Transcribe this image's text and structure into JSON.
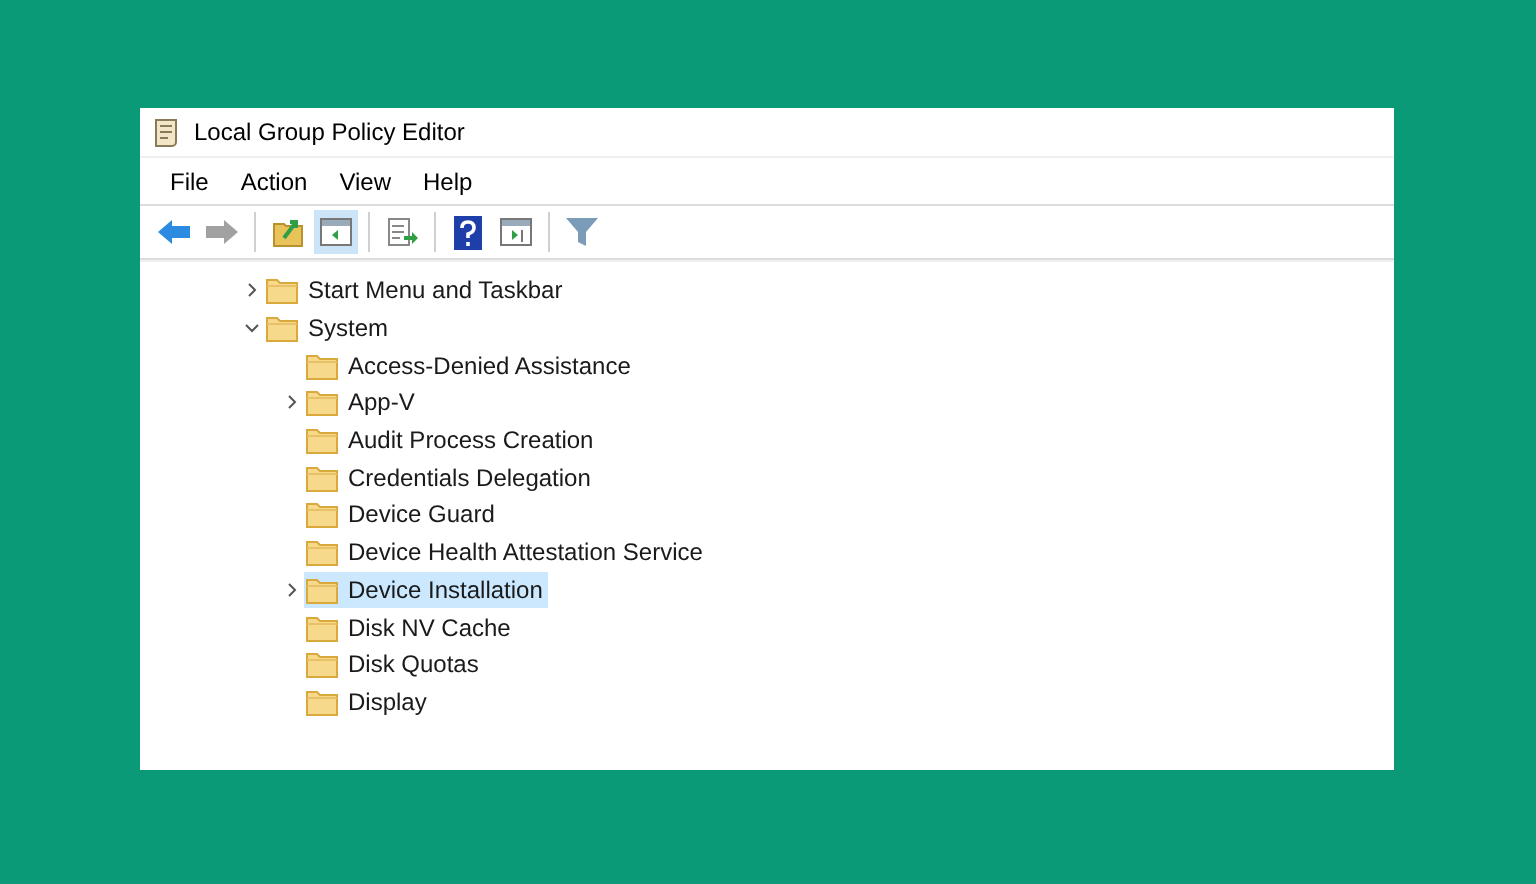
{
  "window": {
    "title": "Local Group Policy Editor"
  },
  "menu": [
    "File",
    "Action",
    "View",
    "Help"
  ],
  "toolbar": [
    {
      "kind": "back",
      "disabled": false,
      "pressed": false
    },
    {
      "kind": "forward",
      "disabled": true,
      "pressed": false
    },
    {
      "kind": "separator"
    },
    {
      "kind": "up",
      "disabled": false,
      "pressed": false
    },
    {
      "kind": "tree-toggle",
      "disabled": false,
      "pressed": true
    },
    {
      "kind": "separator"
    },
    {
      "kind": "export",
      "disabled": false,
      "pressed": false
    },
    {
      "kind": "separator"
    },
    {
      "kind": "help",
      "disabled": false,
      "pressed": false
    },
    {
      "kind": "action-pane",
      "disabled": false,
      "pressed": false
    },
    {
      "kind": "separator"
    },
    {
      "kind": "filter",
      "disabled": false,
      "pressed": false
    }
  ],
  "tree": [
    {
      "label": "Start Menu and Taskbar",
      "expanded": false,
      "selected": false
    },
    {
      "label": "System",
      "expanded": true,
      "selected": false,
      "children": [
        {
          "label": "Access-Denied Assistance",
          "selected": false
        },
        {
          "label": "App-V",
          "expanded": false,
          "selected": false
        },
        {
          "label": "Audit Process Creation",
          "selected": false
        },
        {
          "label": "Credentials Delegation",
          "selected": false
        },
        {
          "label": "Device Guard",
          "selected": false
        },
        {
          "label": "Device Health Attestation Service",
          "selected": false
        },
        {
          "label": "Device Installation",
          "expanded": false,
          "selected": true
        },
        {
          "label": "Disk NV Cache",
          "selected": false
        },
        {
          "label": "Disk Quotas",
          "selected": false
        },
        {
          "label": "Display",
          "selected": false
        }
      ]
    }
  ]
}
